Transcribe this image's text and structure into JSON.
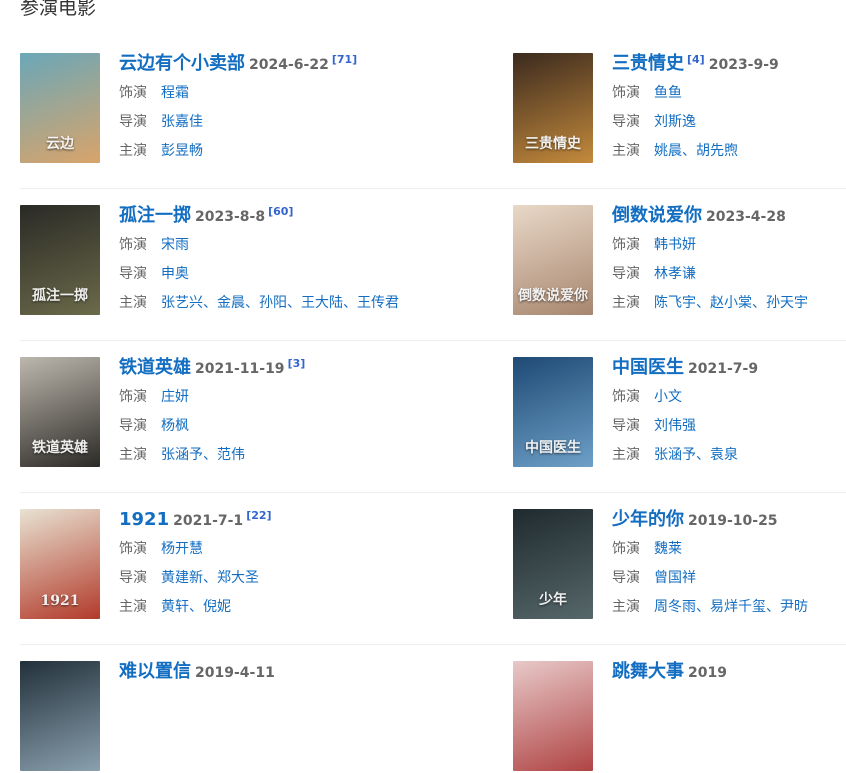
{
  "section_title": "参演电影",
  "labels": {
    "role": "饰演",
    "director": "导演",
    "lead": "主演"
  },
  "movies": [
    {
      "title": "云边有个小卖部",
      "date": "2024-6-22",
      "cite": "[71]",
      "role": [
        "程霜"
      ],
      "director": [
        "张嘉佳"
      ],
      "lead": [
        "彭昱畅"
      ],
      "poster_text": "云边",
      "poster_colors": [
        "#6aa7b8",
        "#d9a46a"
      ]
    },
    {
      "title": "三贵情史",
      "cite": "[4]",
      "date": "2023-9-9",
      "role": [
        "鱼鱼"
      ],
      "director": [
        "刘斯逸"
      ],
      "lead": [
        "姚晨",
        "胡先煦"
      ],
      "poster_text": "三贵情史",
      "poster_colors": [
        "#3b2a1e",
        "#c48a3c"
      ]
    },
    {
      "title": "孤注一掷",
      "date": "2023-8-8",
      "cite": "[60]",
      "role": [
        "宋雨"
      ],
      "director": [
        "申奥"
      ],
      "lead": [
        "张艺兴",
        "金晨",
        "孙阳",
        "王大陆",
        "王传君"
      ],
      "poster_text": "孤注一掷",
      "poster_colors": [
        "#2a2a26",
        "#6b6a4a"
      ]
    },
    {
      "title": "倒数说爱你",
      "date": "2023-4-28",
      "role": [
        "韩书妍"
      ],
      "director": [
        "林孝谦"
      ],
      "lead": [
        "陈飞宇",
        "赵小棠",
        "孙天宇"
      ],
      "poster_text": "倒数说爱你",
      "poster_colors": [
        "#e9d8c8",
        "#a7866e"
      ]
    },
    {
      "title": "铁道英雄",
      "cite": "[3]",
      "date": "2021-11-19",
      "role": [
        "庄妍"
      ],
      "director": [
        "杨枫"
      ],
      "lead": [
        "张涵予",
        "范伟"
      ],
      "poster_text": "铁道英雄",
      "poster_colors": [
        "#bdb8ae",
        "#2c2a26"
      ]
    },
    {
      "title": "中国医生",
      "date": "2021-7-9",
      "role": [
        "小文"
      ],
      "director": [
        "刘伟强"
      ],
      "lead": [
        "张涵予",
        "袁泉"
      ],
      "poster_text": "中国医生",
      "poster_colors": [
        "#1e4a74",
        "#6ea0c8"
      ]
    },
    {
      "title": "1921",
      "date": "2021-7-1",
      "cite": "[22]",
      "role": [
        "杨开慧"
      ],
      "director": [
        "黄建新",
        "郑大圣"
      ],
      "lead": [
        "黄轩",
        "倪妮"
      ],
      "poster_text": "1921",
      "poster_colors": [
        "#e8e2d2",
        "#b23a2a"
      ]
    },
    {
      "title": "少年的你",
      "date": "2019-10-25",
      "role": [
        "魏莱"
      ],
      "director": [
        "曾国祥"
      ],
      "lead": [
        "周冬雨",
        "易烊千玺",
        "尹昉"
      ],
      "poster_text": "少年",
      "poster_colors": [
        "#1f2a2e",
        "#56676a"
      ]
    },
    {
      "title": "难以置信",
      "date": "2019-4-11",
      "role": [],
      "director": [],
      "lead": [],
      "poster_text": "",
      "poster_colors": [
        "#22303a",
        "#8aa0ae"
      ]
    },
    {
      "title": "跳舞大事",
      "date": "2019",
      "role": [],
      "director": [],
      "lead": [],
      "poster_text": "",
      "poster_colors": [
        "#e8c9c9",
        "#b04444"
      ]
    }
  ]
}
